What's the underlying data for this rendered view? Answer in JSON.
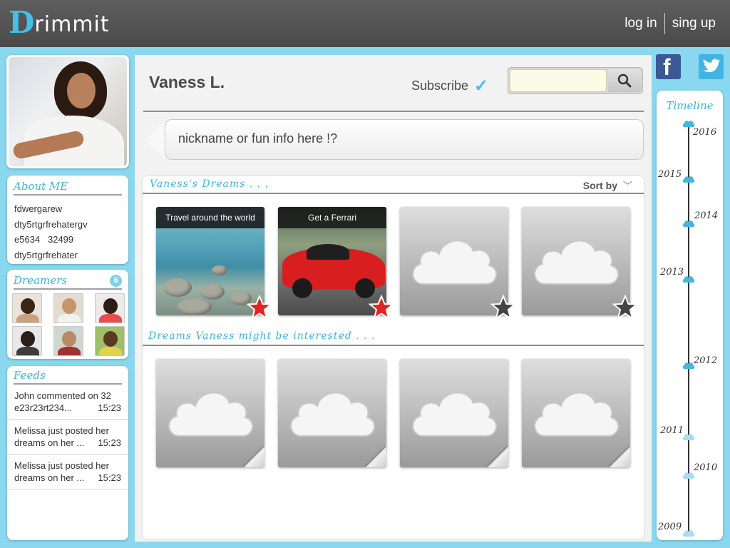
{
  "header": {
    "logo_mark": "D",
    "logo_text": "rimmit",
    "login": "log in",
    "signup": "sing up"
  },
  "about": {
    "title": "About ME",
    "lines": [
      "fdwergarew",
      "dty5rtgrfrehatergv",
      "e5634   32499",
      "dty5rtgrfrehater"
    ]
  },
  "dreamers": {
    "title": "Dreamers",
    "count": "6"
  },
  "feeds": {
    "title": "Feeds",
    "items": [
      {
        "line1": "John commented on 32",
        "line2": "e23r23rt234...",
        "time": "15:23"
      },
      {
        "line1": "Melissa just posted her",
        "line2": "dreams on her ...",
        "time": "15:23"
      },
      {
        "line1": "Melissa just posted her",
        "line2": "dreams on her ...",
        "time": "15:23"
      }
    ]
  },
  "profile": {
    "name": "Vaness L.",
    "subscribe": "Subscribe",
    "bubble": "nickname or fun info here !?"
  },
  "search": {
    "value": "",
    "placeholder": ""
  },
  "dreams": {
    "title": "Vaness's Dreams . . .",
    "sort_label": "Sort by",
    "cards": [
      {
        "title": "Travel around the world",
        "starred": true
      },
      {
        "title": "Get a Ferrari",
        "starred": true
      },
      {
        "title": "",
        "starred": false
      },
      {
        "title": "",
        "starred": false
      }
    ]
  },
  "interested": {
    "title": "Dreams Vaness might be interested . . ."
  },
  "timeline": {
    "title": "Timeline",
    "years": [
      "2016",
      "2015",
      "2014",
      "2013",
      "2012",
      "2011",
      "2010",
      "2009"
    ]
  },
  "colors": {
    "accent": "#43c0e6",
    "header_bg": "#555555",
    "page_bg": "#89d8ef",
    "star_active": "#e32222",
    "star_inactive": "#444444"
  },
  "icons": {
    "search": "search-icon",
    "subscribe": "check-icon",
    "facebook": "facebook-icon",
    "twitter": "twitter-icon"
  }
}
